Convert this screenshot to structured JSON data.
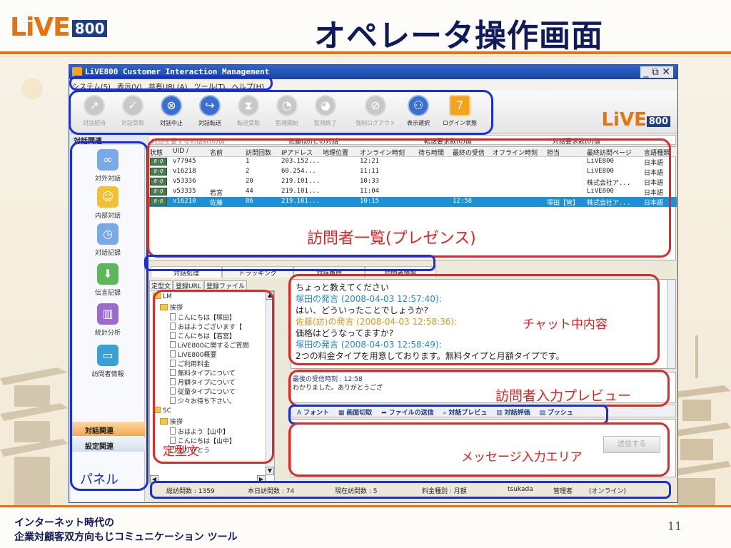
{
  "slide": {
    "logo_text": "LiVE",
    "logo_number": "800",
    "title": "オペレータ操作画面",
    "footer_line1": "インターネット時代の",
    "footer_line2": "企業対顧客双方向もじコミュニケーション ツール",
    "page_number": "11"
  },
  "app": {
    "window_title": "LiVE800 Customer Interaction Management",
    "window_controls": "_ ⧉ ✕",
    "menu": [
      "システム(S)",
      "表示(V)",
      "共有URL(A)",
      "ツール(T)",
      "ヘルプ(H)"
    ],
    "toolbar": [
      {
        "label": "対話招待",
        "icon": "↗",
        "enabled": false
      },
      {
        "label": "対話受取",
        "icon": "✓",
        "enabled": false
      },
      {
        "label": "対話中止",
        "icon": "⊗",
        "enabled": true
      },
      {
        "label": "対話転送",
        "icon": "↪",
        "enabled": true
      },
      {
        "label": "転送受取",
        "icon": "⧗",
        "enabled": false
      },
      {
        "label": "監視開始",
        "icon": "◔",
        "enabled": false
      },
      {
        "label": "監視終了",
        "icon": "◕",
        "enabled": false
      },
      {
        "label": "強制ログアウト",
        "icon": "⊘",
        "enabled": false
      },
      {
        "label": "表示選択",
        "icon": "⚇",
        "enabled": true
      },
      {
        "label": "ログイン状態",
        "icon": "7",
        "enabled": true
      }
    ],
    "toolbar_logo": "LiVE",
    "toolbar_logo_number": "800",
    "panel_header": "対話関連",
    "panel_items": [
      "対外対話",
      "内部対話",
      "対話記録",
      "伝言記録",
      "統計分析",
      "訪問者情報"
    ],
    "panel_buttons": [
      "対話関連",
      "設定関連"
    ],
    "filter": {
      "search_placeholder": "対話を要する対話数(0)個",
      "filter2": "佐藤(訪)との対話",
      "filter3": "転送要求数(0)個",
      "filter4": "対話要求数(0)個"
    },
    "visitor_columns": [
      "状態",
      "UID /",
      "名前",
      "訪問回数",
      "IPアドレス",
      "地理位置",
      "オンライン時刻",
      "待ち時間",
      "最終の受信",
      "オフライン時刻",
      "担当",
      "最終訪問ページ",
      "言語種類"
    ],
    "visitors": [
      {
        "uid": "v77945",
        "name": "",
        "visits": "1",
        "ip": "203.152...",
        "online": "12:21",
        "last_rx": "",
        "staff": "",
        "page": "LiVE800",
        "lang": "日本語"
      },
      {
        "uid": "v16218",
        "name": "",
        "visits": "2",
        "ip": "60.254...",
        "online": "11:11",
        "last_rx": "",
        "staff": "",
        "page": "LiVE800",
        "lang": "日本語"
      },
      {
        "uid": "v53336",
        "name": "",
        "visits": "20",
        "ip": "219.101...",
        "online": "10:33",
        "last_rx": "",
        "staff": "",
        "page": "株式会社ア...",
        "lang": "日本語"
      },
      {
        "uid": "v53335",
        "name": "若宮",
        "visits": "44",
        "ip": "219.101...",
        "online": "11:04",
        "last_rx": "",
        "staff": "",
        "page": "LiVE800",
        "lang": "日本語"
      },
      {
        "uid": "v16210",
        "name": "佐藤",
        "visits": "86",
        "ip": "219.101...",
        "online": "10:15",
        "last_rx": "12:58",
        "staff": "塚田【管】",
        "page": "株式会社ア...",
        "lang": "日本語"
      }
    ],
    "tabs": [
      "対話処理",
      "トラッキング",
      "対話履歴",
      "訪問者情報"
    ],
    "subtabs": [
      "定型文",
      "登録URL",
      "登録ファイル"
    ],
    "tree": [
      {
        "kind": "folder",
        "label": "LM",
        "indent": 0
      },
      {
        "kind": "folder",
        "label": "挨拶",
        "indent": 1
      },
      {
        "kind": "doc",
        "label": "こんにちは【塚田】",
        "indent": 2
      },
      {
        "kind": "doc",
        "label": "おはようございます【",
        "indent": 2
      },
      {
        "kind": "doc",
        "label": "こんにちは【若宮】",
        "indent": 2
      },
      {
        "kind": "doc",
        "label": "LiVE800に関するご質問",
        "indent": 2
      },
      {
        "kind": "doc",
        "label": "LiVE800概要",
        "indent": 2
      },
      {
        "kind": "doc",
        "label": "ご利用料金",
        "indent": 2
      },
      {
        "kind": "doc",
        "label": "無料タイプについて",
        "indent": 2
      },
      {
        "kind": "doc",
        "label": "月額タイプについて",
        "indent": 2
      },
      {
        "kind": "doc",
        "label": "従量タイプについて",
        "indent": 2
      },
      {
        "kind": "doc",
        "label": "少々お待ち下さい。",
        "indent": 2
      },
      {
        "kind": "folder",
        "label": "SC",
        "indent": 0
      },
      {
        "kind": "folder",
        "label": "挨拶",
        "indent": 1
      },
      {
        "kind": "doc",
        "label": "おはよう【山中】",
        "indent": 2
      },
      {
        "kind": "doc",
        "label": "こんにちは【山中】",
        "indent": 2
      },
      {
        "kind": "doc",
        "label": "ありがとう",
        "indent": 2
      }
    ],
    "chat": [
      {
        "style": "text",
        "text": "ちょっと教えてください"
      },
      {
        "style": "staff",
        "text": "塚田の発言 (2008-04-03 12:57:40):"
      },
      {
        "style": "text",
        "text": "はい、どういったことでしょうか?"
      },
      {
        "style": "visitor",
        "text": "佐藤(訪)の発言 (2008-04-03 12:58:36):"
      },
      {
        "style": "text",
        "text": "価格はどうなってますか?"
      },
      {
        "style": "staff",
        "text": "塚田の発言 (2008-04-03 12:58:49):"
      },
      {
        "style": "text",
        "text": "2つの料金タイプを用意しております。無料タイプと月額タイプです。"
      }
    ],
    "preview": {
      "time_label": "最後の受信時刻 : 12:58",
      "text": "わかりました。ありがとうござ"
    },
    "message_tools": [
      "フォント",
      "画面切取",
      "ファイルの送信",
      "対話プレビュ",
      "対話評価",
      "プッシュ"
    ],
    "send_button": "送信する",
    "status": {
      "total": "総訪問数 : 1359",
      "today": "本日訪問数 : 74",
      "current": "現在訪問数 : 5",
      "plan": "料金種別 : 月額",
      "user": "tsukada",
      "role": "管理者",
      "state": "(オンライン)"
    }
  },
  "annotations": {
    "visitors": "訪問者一覧(プレゼンス)",
    "chat": "チャット中内容",
    "preview": "訪問者入力プレビュー",
    "templates": "定型文",
    "message": "メッセージ入力エリア",
    "panel": "パネル"
  },
  "colors": {
    "accent": "#e8730c",
    "navy": "#0f1a5c",
    "ring_blue": "#1b2fd8",
    "ring_red": "#dc2a2a",
    "selected_row": "#1e90d8"
  }
}
